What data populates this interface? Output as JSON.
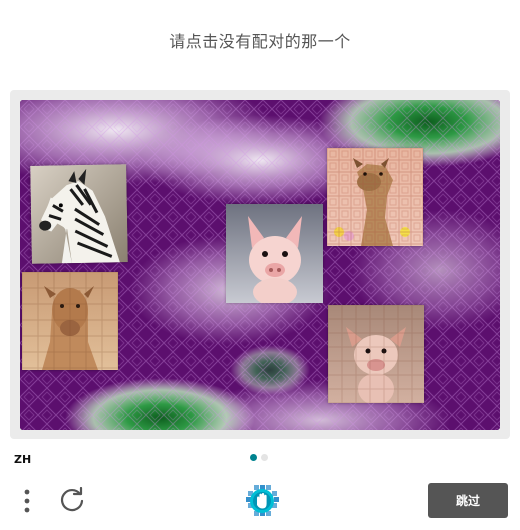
{
  "prompt": {
    "text": "请点击没有配对的那一个"
  },
  "challenge": {
    "tiles": [
      {
        "animal": "zebra"
      },
      {
        "animal": "camel"
      },
      {
        "animal": "pig"
      },
      {
        "animal": "camel"
      },
      {
        "animal": "pig"
      }
    ]
  },
  "footer": {
    "language": "ZH",
    "pagination": {
      "current": 1,
      "total": 2
    },
    "icons": {
      "menu": "more-vertical-icon",
      "refresh": "refresh-icon",
      "logo": "hcaptcha-logo-icon"
    },
    "skip_label": "跳过"
  },
  "colors": {
    "background_purple": "#5c0f6e",
    "accent_teal": "#00838f",
    "skip_button": "#555555"
  }
}
